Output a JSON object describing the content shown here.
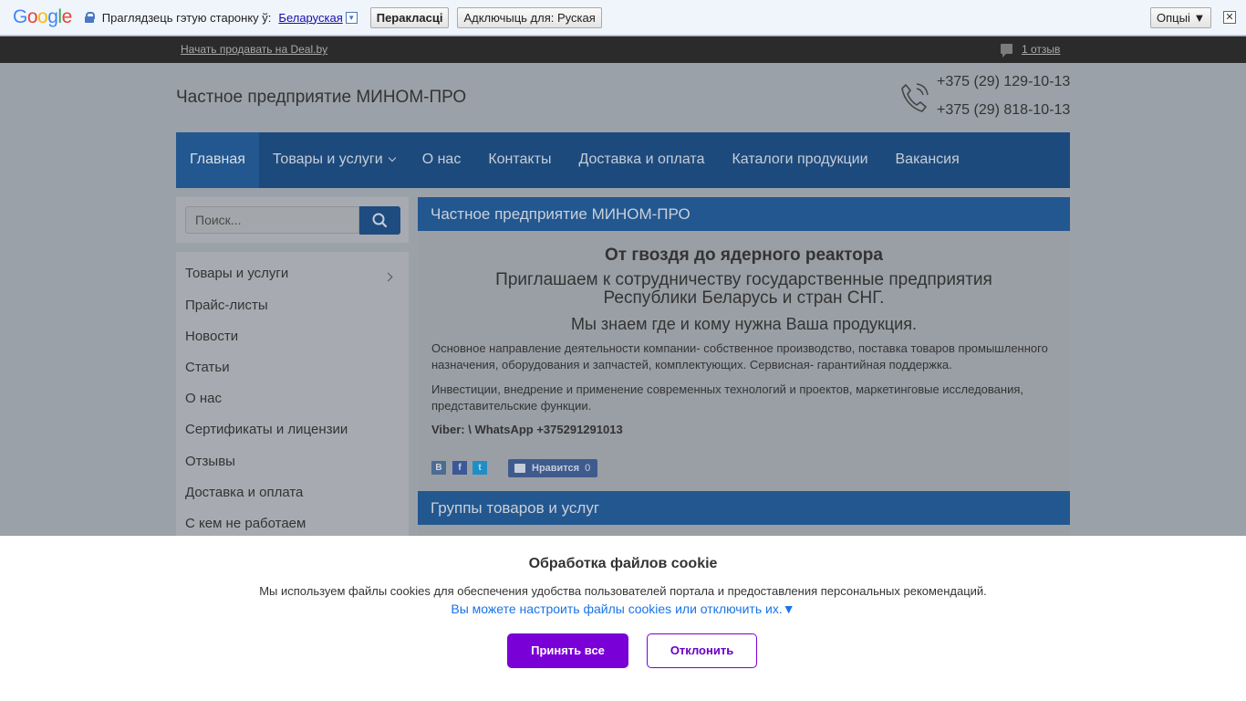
{
  "translate_bar": {
    "logo": [
      "G",
      "o",
      "o",
      "g",
      "l",
      "e"
    ],
    "prompt": "Праглядзець гэтую старонку ў:",
    "language": "Беларуская",
    "translate_button": "Перакласці",
    "disable_button": "Адключыць для: Руская",
    "options_button": "Опцыі ▼",
    "close": "✕"
  },
  "top_strip": {
    "sell_link": "Начать продавать на Deal.by",
    "reviews_link": "1 отзыв"
  },
  "header": {
    "company": "Частное предприятие МИНОМ-ПРО",
    "phones": [
      "+375 (29) 129-10-13",
      "+375 (29) 818-10-13"
    ]
  },
  "nav": {
    "items": [
      "Главная",
      "Товары и услуги",
      "О нас",
      "Контакты",
      "Доставка и оплата",
      "Каталоги продукции",
      "Вакансия"
    ]
  },
  "search": {
    "placeholder": "Поиск..."
  },
  "sidebar": {
    "items": [
      "Товары и услуги",
      "Прайс-листы",
      "Новости",
      "Статьи",
      "О нас",
      "Сертификаты и лицензии",
      "Отзывы",
      "Доставка и оплата",
      "С кем не работаем"
    ]
  },
  "main": {
    "header": "Частное предприятие МИНОМ-ПРО",
    "headline": "От гвоздя до ядерного реактора",
    "subhead": "Приглашаем к сотрудничеству государственные предприятия Республики Беларусь и стран СНГ.",
    "subhead2": "Мы знаем где и кому нужна Ваша продукция.",
    "para1": "Основное направление деятельности компании- собственное производство, поставка товаров промышленного назначения, оборудования и запчастей, комплектующих. Сервисная- гарантийная поддержка.",
    "para2": "Инвестиции, внедрение и применение современных технологий и проектов, маркетинговые исследования, представительские функции.",
    "contact": "Viber: \\ WhatsApp +375291291013",
    "social": [
      "В",
      "f",
      "t"
    ],
    "like_label": "Нравится",
    "like_count": "0",
    "groups_header": "Группы товаров и услуг"
  },
  "cookie": {
    "title": "Обработка файлов cookie",
    "text": "Мы используем файлы cookies для обеспечения удобства пользователей портала и предоставления персональных рекомендаций.",
    "settings_link": "Вы можете настроить файлы cookies или отключить их.▼",
    "accept": "Принять все",
    "reject": "Отклонить"
  }
}
